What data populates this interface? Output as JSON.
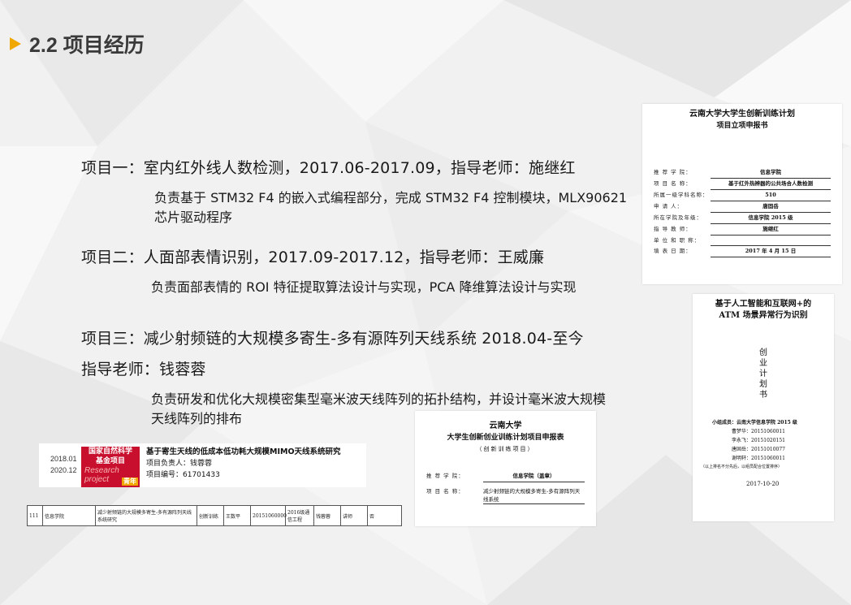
{
  "slide": {
    "title": "2.2 项目经历",
    "accent_color": "#f0a800"
  },
  "projects": [
    {
      "heading": "项目一：室内红外线人数检测，2017.06-2017.09，指导老师：施继红",
      "desc": "负责基于 STM32 F4 的嵌入式编程部分，完成 STM32 F4 控制模块，MLX90621 芯片驱动程序"
    },
    {
      "heading": "项目二：人面部表情识别，2017.09-2017.12，指导老师：王威廉",
      "desc": "负责面部表情的 ROI 特征提取算法设计与实现，PCA 降维算法设计与实现"
    },
    {
      "heading": "项目三：减少射频链的大规模多寄生-多有源阵列天线系统 2018.04-至今",
      "heading2": "指导老师：钱蓉蓉",
      "desc": "负责研发和优化大规模密集型毫米波天线阵列的拓扑结构，并设计毫米波大规模天线阵列的排布"
    }
  ],
  "doc1": {
    "title1": "云南大学大学生创新训练计划",
    "title2": "项目立项申报书",
    "rows": [
      {
        "k": "推 荐 学 院：",
        "v": "信息学院"
      },
      {
        "k": "项 目 名 称：",
        "v": "基于红外热辨器的公共场合人数检测"
      },
      {
        "k": "所属一级学科名称：",
        "v": "510"
      },
      {
        "k": "申  请  人：",
        "v": "唐固岳"
      },
      {
        "k": "所在学院及年级：",
        "v": "信息学院 2015 级"
      },
      {
        "k": "指 导 教 师：",
        "v": "施继红"
      },
      {
        "k": "单 位 和 职 称：",
        "v": ""
      },
      {
        "k": "填 表 日 期：",
        "v": "2017 年 4 月 15 日"
      }
    ]
  },
  "doc2": {
    "title1": "基于人工智能和互联网+的",
    "title2": "ATM 场景异常行为识别",
    "vertical": [
      "创",
      "业",
      "计",
      "划",
      "书"
    ],
    "members_label": "小组成员：",
    "members_school": "云南大学信息学院 2015 级",
    "members": [
      "曹梦华：20151060011",
      "李永飞：20151020151",
      "唐固岳：20151010077",
      "谢明轩：20151060011"
    ],
    "note": "（以上排名不分先后，以组员配合位置排序）",
    "date": "2017-10-20"
  },
  "doc3": {
    "title1": "云南大学",
    "title2": "大学生创新创业训练计划项目申报表",
    "subtitle": "（创新训练项目）",
    "rows": [
      {
        "k": "推 荐 学 院：",
        "v": "信息学院（盖章）"
      },
      {
        "k": "项 目 名 称：",
        "v": "减少射频链的大规模多寄生-多有源阵列天线系统"
      }
    ]
  },
  "banner": {
    "date_start": "2018.01",
    "date_end": "2020.12",
    "logo_text1": "国家自然科学",
    "logo_text2": "基金项目",
    "logo_en1": "Research",
    "logo_en2": "project",
    "logo_tag": "青年",
    "project_title": "基于寄生天线的低成本低功耗大规模MIMO天线系统研究",
    "leader": "项目负责人：钱蓉蓉",
    "number": "项目编号：61701433"
  },
  "table_row": {
    "cells": [
      "111",
      "信息学院",
      "减少射频链的大规模多寄生-多有源阵列天线系统研究",
      "创新训练",
      "王数平",
      "20151060000",
      "2016级通信工程",
      "钱蓉蓉",
      "讲师",
      "否"
    ]
  }
}
